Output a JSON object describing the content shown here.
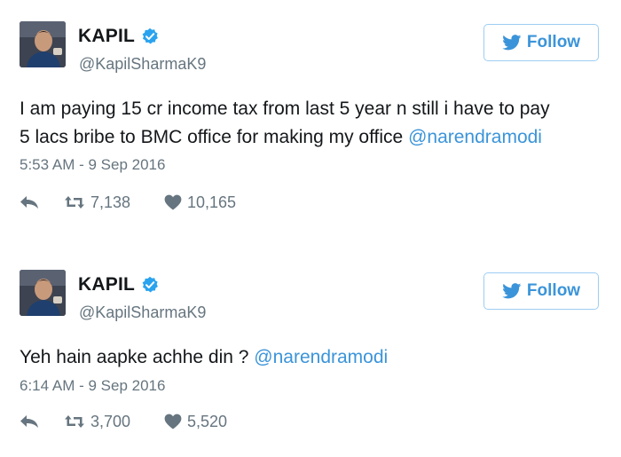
{
  "colors": {
    "link": "#3b94d9",
    "muted": "#66757f",
    "text": "#14171a",
    "verified": "#1da1f2",
    "follow_border": "#9ecdf2"
  },
  "icons": {
    "verified": "verified-badge-icon",
    "bird": "twitter-bird-icon",
    "reply": "reply-icon",
    "retweet": "retweet-icon",
    "like": "heart-icon"
  },
  "tweets": [
    {
      "display_name": "KAPIL",
      "handle": "@KapilSharmaK9",
      "follow_label": "Follow",
      "text_lines": [
        {
          "text": "I am paying 15 cr income tax from last 5 year n still i have to pay",
          "mention": ""
        },
        {
          "text": "5 lacs bribe to BMC office for making my office ",
          "mention": "@narendramodi"
        }
      ],
      "timestamp": "5:53 AM - 9 Sep 2016",
      "retweets": "7,138",
      "likes": "10,165"
    },
    {
      "display_name": "KAPIL",
      "handle": "@KapilSharmaK9",
      "follow_label": "Follow",
      "text_lines": [
        {
          "text": "Yeh hain aapke achhe din ? ",
          "mention": "@narendramodi"
        }
      ],
      "timestamp": "6:14 AM - 9 Sep 2016",
      "retweets": "3,700",
      "likes": "5,520"
    }
  ]
}
